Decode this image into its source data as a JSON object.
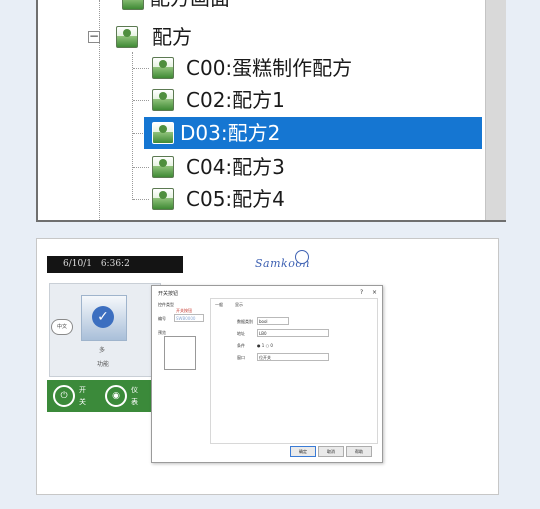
{
  "tree": {
    "top_label": "配方画面",
    "root_label": "配方",
    "items": [
      {
        "label": "C00:蛋糕制作配方"
      },
      {
        "label": "C02:配方1"
      },
      {
        "label": "D03:配方2",
        "selected": true
      },
      {
        "label": "C04:配方3"
      },
      {
        "label": "C05:配方4"
      }
    ]
  },
  "hmi": {
    "datetime": "6/10/1 6:36:2",
    "brand": "Samkoon",
    "lang_button": "中文",
    "card_text_1": "多",
    "card_text_2": "功能",
    "green_labels": [
      "开",
      "关",
      "仪",
      "表"
    ]
  },
  "dialog": {
    "title": "开关按钮",
    "help": "?",
    "close": "×",
    "left": {
      "type_label": "控件类型",
      "type_value": "开关按钮",
      "id_label": "编号",
      "id_value": "SWB0000",
      "preview_label": "预览"
    },
    "tabs": [
      "一般",
      "显示"
    ],
    "fields": [
      {
        "label": "数据类别",
        "value": "bool"
      },
      {
        "label": "地址",
        "value": "LB0"
      },
      {
        "label": "条件",
        "value": "● 1  ○ 0"
      },
      {
        "label": "窗口",
        "value": "位开关"
      }
    ],
    "buttons": {
      "ok": "确定",
      "cancel": "取消",
      "help": "帮助"
    }
  },
  "colors": {
    "selection": "#1576d2",
    "hmi_green": "#3b8a3a",
    "brand": "#3f62b3"
  }
}
